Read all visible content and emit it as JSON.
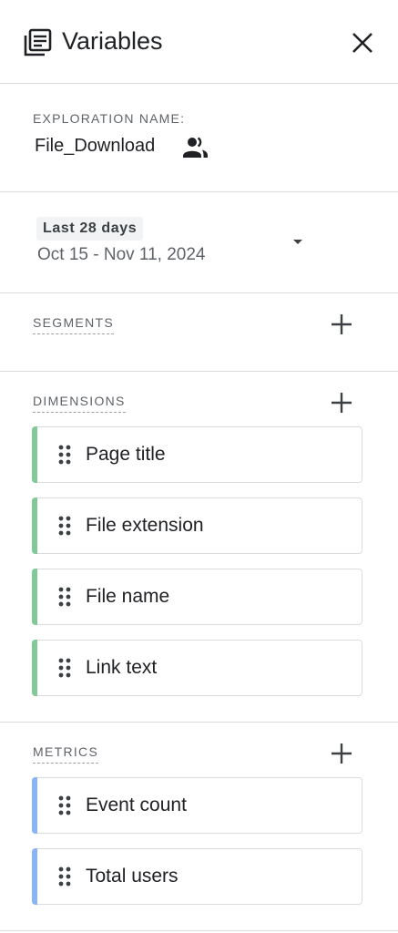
{
  "header": {
    "title": "Variables",
    "icon": "report-icon",
    "close_icon": "close-icon"
  },
  "exploration": {
    "caption": "EXPLORATION NAME:",
    "name": "File_Download",
    "shared_icon": "people-icon"
  },
  "date": {
    "preset": "Last 28 days",
    "range": "Oct 15 - Nov 11, 2024"
  },
  "segments": {
    "label": "SEGMENTS"
  },
  "dimensions": {
    "label": "DIMENSIONS",
    "items": [
      {
        "label": "Page title"
      },
      {
        "label": "File extension"
      },
      {
        "label": "File name"
      },
      {
        "label": "Link text"
      }
    ],
    "accent": "#81c995"
  },
  "metrics": {
    "label": "METRICS",
    "items": [
      {
        "label": "Event count"
      },
      {
        "label": "Total users"
      }
    ],
    "accent": "#8ab4f8"
  },
  "colors": {
    "divider": "#dadce0",
    "text": "#202124",
    "muted": "#5f6368"
  }
}
